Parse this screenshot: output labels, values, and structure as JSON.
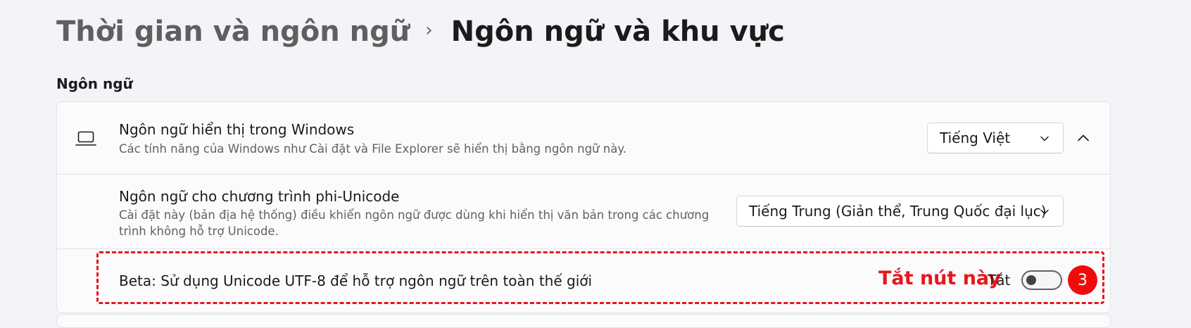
{
  "breadcrumb": {
    "parent": "Thời gian và ngôn ngữ",
    "separator": "›",
    "current": "Ngôn ngữ và khu vực"
  },
  "section": {
    "title": "Ngôn ngữ"
  },
  "display_language": {
    "icon": "laptop-icon",
    "title": "Ngôn ngữ hiển thị trong Windows",
    "description": "Các tính năng của Windows như Cài đặt và File Explorer sẽ hiển thị bằng ngôn ngữ này.",
    "selected": "Tiếng Việt",
    "expanded": true
  },
  "non_unicode": {
    "title": "Ngôn ngữ cho chương trình phi-Unicode",
    "description_line1": "Cài đặt này (bản địa hệ thống) điều khiển ngôn ngữ được dùng khi hiển thị văn bản trong các chương",
    "description_line2": "trình không hỗ trợ Unicode.",
    "selected": "Tiếng Trung (Giản thể, Trung Quốc đại lục)"
  },
  "beta_utf8": {
    "title": "Beta: Sử dụng Unicode UTF-8 để hỗ trợ ngôn ngữ trên toàn thế giới",
    "toggle_label": "Tắt",
    "toggle_on": false
  },
  "annotation": {
    "text": "Tắt nút này",
    "step": "3",
    "color": "#e8161c"
  }
}
